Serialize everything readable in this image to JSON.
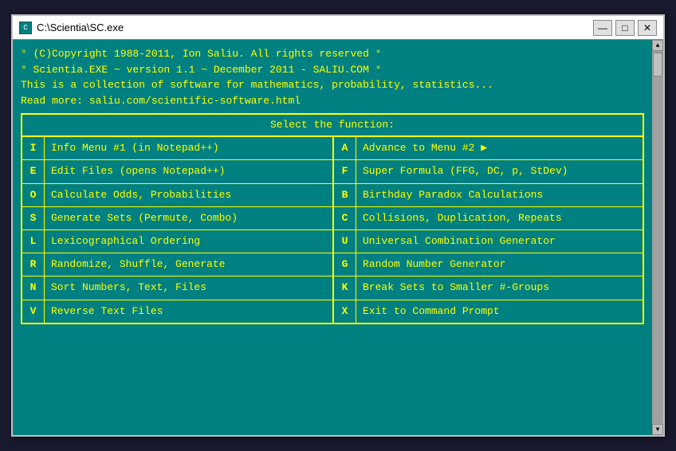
{
  "window": {
    "title": "C:\\Scientia\\SC.exe",
    "icon_label": "C"
  },
  "titlebar_buttons": {
    "minimize": "—",
    "maximize": "□",
    "close": "✕"
  },
  "header": {
    "line1": "° (C)Copyright 1988-2011, Ion Saliu. All rights reserved  °",
    "line2": "° Scientia.EXE ~ version 1.1 ~ December 2011 - SALIU.COM °",
    "line3": "This is a collection of software for mathematics, probability, statistics...",
    "line4": "Read more: saliu.com/scientific-software.html"
  },
  "menu": {
    "title": "Select the function:",
    "left_items": [
      {
        "key": "I",
        "label": "Info Menu #1 (in Notepad++)"
      },
      {
        "key": "E",
        "label": "Edit Files (opens Notepad++)"
      },
      {
        "key": "O",
        "label": "Calculate Odds, Probabilities"
      },
      {
        "key": "S",
        "label": "Generate Sets (Permute, Combo)"
      },
      {
        "key": "L",
        "label": "Lexicographical Ordering"
      },
      {
        "key": "R",
        "label": "Randomize, Shuffle, Generate"
      },
      {
        "key": "N",
        "label": "Sort Numbers, Text, Files"
      },
      {
        "key": "V",
        "label": "Reverse Text Files"
      }
    ],
    "right_items": [
      {
        "key": "A",
        "label": "Advance to Menu #2 ▶",
        "has_arrow": true
      },
      {
        "key": "F",
        "label": "Super Formula (FFG, DC, p, StDev)"
      },
      {
        "key": "B",
        "label": "Birthday Paradox Calculations"
      },
      {
        "key": "C",
        "label": "Collisions, Duplication, Repeats"
      },
      {
        "key": "U",
        "label": "Universal Combination Generator"
      },
      {
        "key": "G",
        "label": "Random Number Generator"
      },
      {
        "key": "K",
        "label": "Break Sets to Smaller #-Groups"
      },
      {
        "key": "X",
        "label": "Exit to Command Prompt"
      }
    ]
  }
}
